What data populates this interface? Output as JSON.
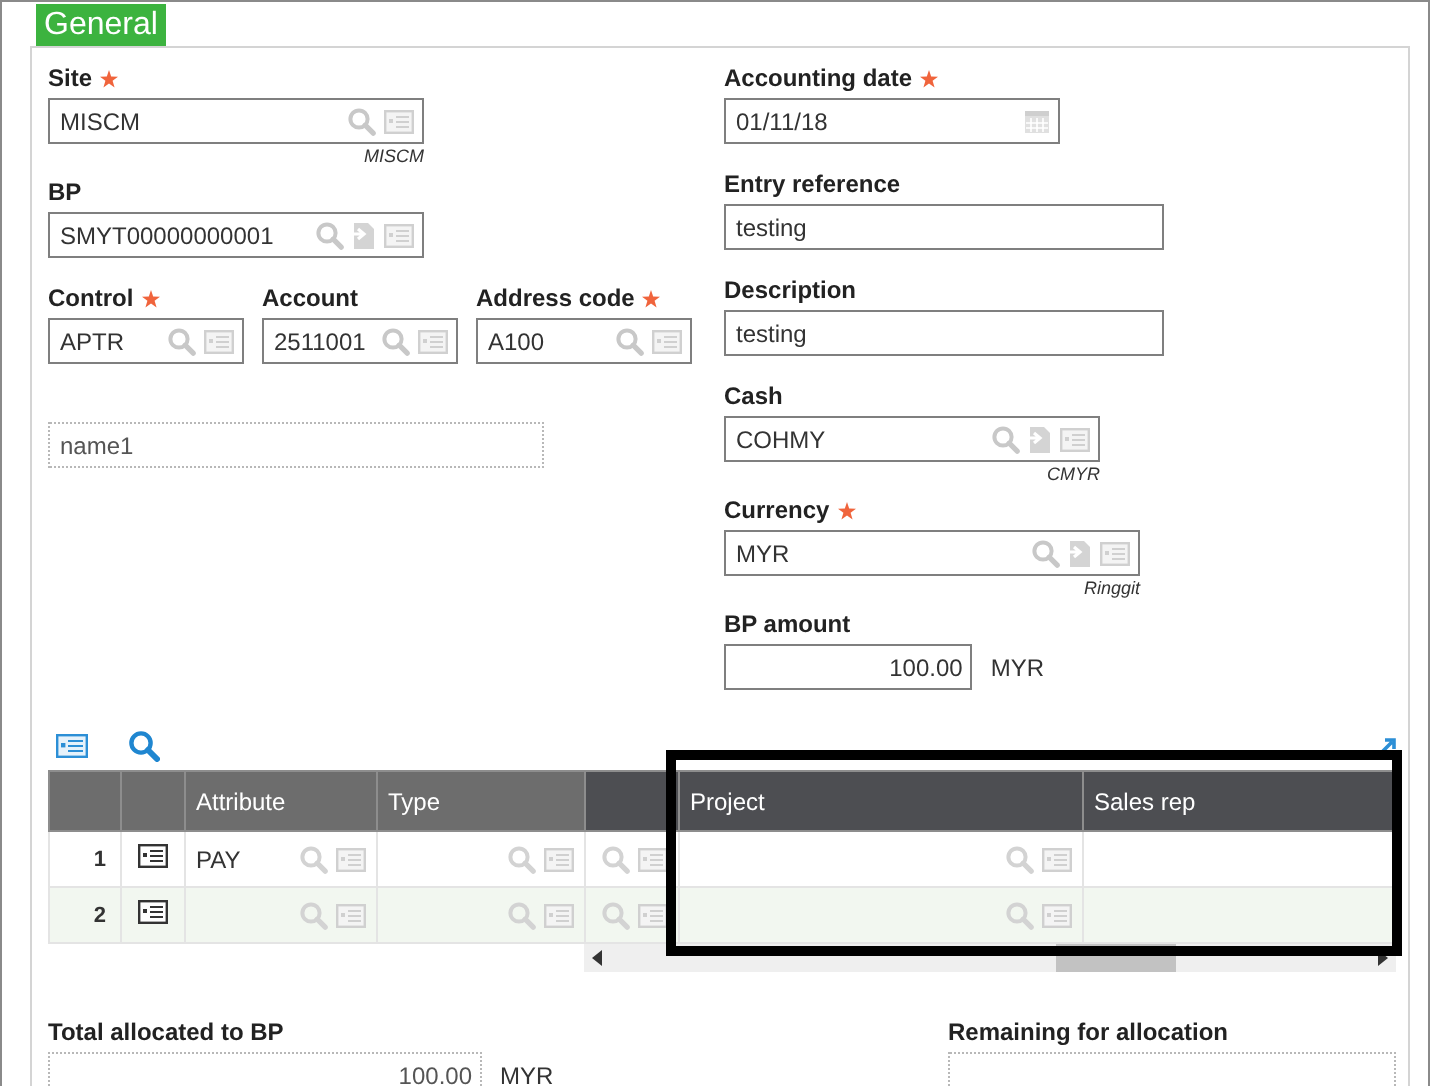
{
  "tab": {
    "label": "General",
    "selected": true
  },
  "left_rows": [
    [
      {
        "label": "Site",
        "required": true,
        "value": "MISCM",
        "kind": "lookup",
        "sublabel": "MISCM"
      }
    ],
    [
      {
        "label": "BP",
        "required": false,
        "value": "SMYT00000000001",
        "kind": "lookup_jump"
      }
    ],
    [
      {
        "label": "Control",
        "required": true,
        "value": "APTR",
        "kind": "lookup"
      },
      {
        "label": "Account",
        "required": false,
        "value": "2511001",
        "kind": "lookup"
      },
      {
        "label": "Address code",
        "required": true,
        "value": "A100",
        "kind": "lookup"
      }
    ],
    [
      {
        "value": "name1",
        "kind": "readonly"
      }
    ]
  ],
  "right_fields": [
    {
      "label": "Accounting date",
      "required": true,
      "value": "01/11/18",
      "kind": "date"
    },
    {
      "label": "Entry reference",
      "required": false,
      "value": "testing",
      "kind": "text"
    },
    {
      "label": "Description",
      "required": false,
      "value": "testing",
      "kind": "text"
    },
    {
      "label": "Cash",
      "required": false,
      "value": "COHMY",
      "kind": "lookup_jump",
      "sublabel": "CMYR"
    },
    {
      "label": "Currency",
      "required": true,
      "value": "MYR",
      "kind": "lookup_jump",
      "sublabel": "Ringgit"
    },
    {
      "label": "BP amount",
      "required": false,
      "value": "100.00",
      "kind": "amount",
      "unit": "MYR"
    }
  ],
  "table": {
    "columns": [
      {
        "kind": "number"
      },
      {
        "kind": "icon"
      },
      {
        "label": "Attribute",
        "kind": "lookup"
      },
      {
        "label": "Type",
        "kind": "lookup"
      },
      {
        "kind": "lookup"
      },
      {
        "label": "Project",
        "kind": "lookup"
      },
      {
        "label": "Sales rep",
        "kind": "text"
      }
    ],
    "rows": [
      {
        "number": "1",
        "attribute": "PAY"
      },
      {
        "number": "2"
      }
    ]
  },
  "totals": [
    {
      "label": "Total allocated to BP",
      "value": "100.00",
      "unit": "MYR"
    },
    {
      "label": "Remaining for allocation"
    }
  ]
}
